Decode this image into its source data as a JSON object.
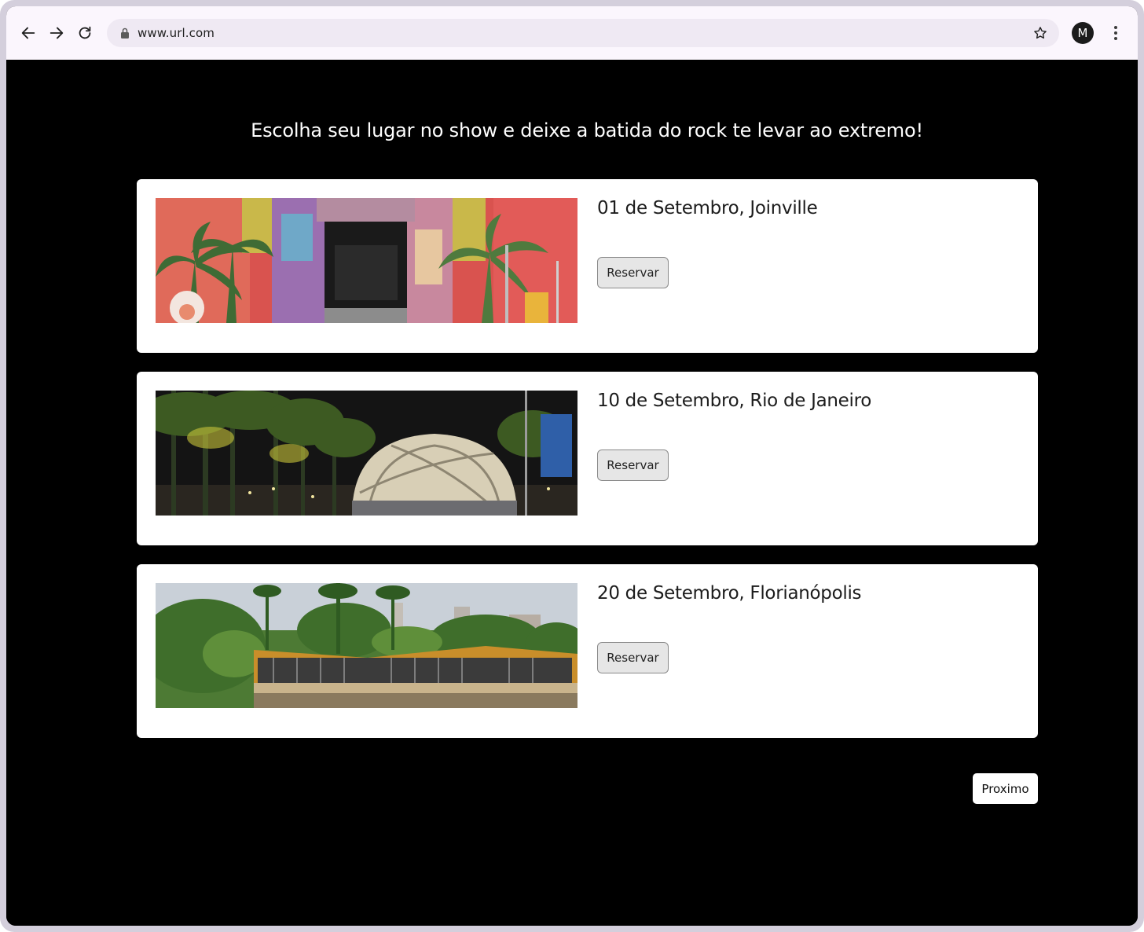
{
  "browser": {
    "url": "www.url.com",
    "profile_initial": "M",
    "icons": {
      "back": "arrow-left-icon",
      "forward": "arrow-right-icon",
      "reload": "reload-icon",
      "lock": "lock-icon",
      "bookmark": "star-icon",
      "menu": "kebab-menu-icon"
    }
  },
  "page": {
    "headline": "Escolha seu lugar no show e deixe a batida do rock te levar ao extremo!",
    "events": [
      {
        "title": "01 de Setembro, Joinville",
        "button_label": "Reservar",
        "image": "venue-mural-building-photo"
      },
      {
        "title": "10 de Setembro, Rio de Janeiro",
        "button_label": "Reservar",
        "image": "venue-dome-night-photo"
      },
      {
        "title": "20 de Setembro, Florianópolis",
        "button_label": "Reservar",
        "image": "venue-modernist-building-photo"
      }
    ],
    "next_label": "Proximo"
  },
  "colors": {
    "background": "#000000",
    "card": "#ffffff",
    "toolbar": "#fbf6fd",
    "omnibox": "#efe9f3",
    "button": "#e6e6e6"
  }
}
